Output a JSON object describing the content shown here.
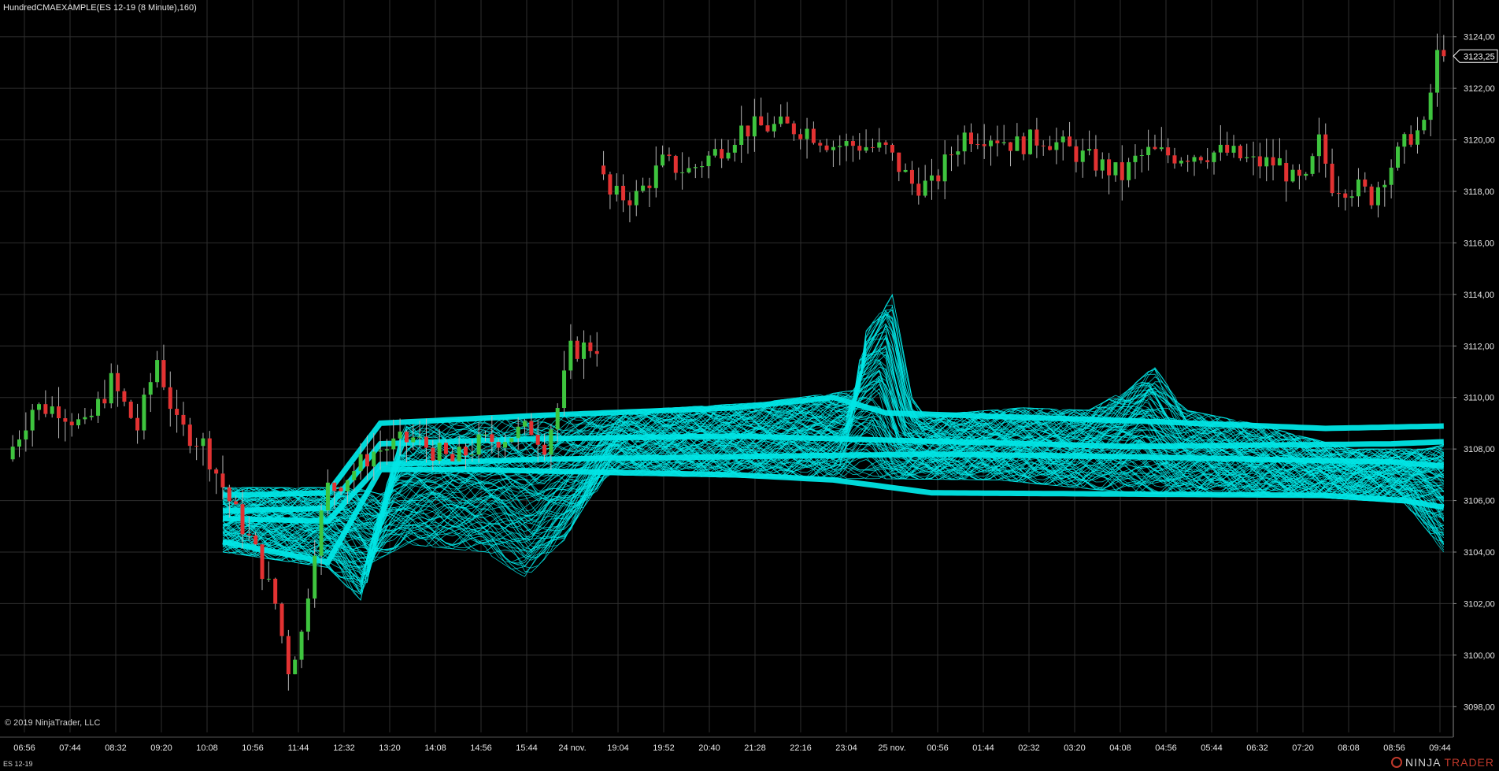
{
  "header": {
    "title": "HundredCMAEXAMPLE(ES 12-19 (8 Minute),160)"
  },
  "footer": {
    "copyright": "© 2019 NinjaTrader, LLC",
    "instrument": "ES 12-19",
    "logo_left": "NINJA",
    "logo_right": "TRADER"
  },
  "colors": {
    "background": "#000000",
    "grid": "#2e2e2e",
    "axis_text": "#e6e6e6",
    "up_candle": "#3ec43e",
    "down_candle": "#e23232",
    "wick": "#b4b4b4",
    "ma_lines": "#00e5e5",
    "price_marker": "#ffffff"
  },
  "chart_data": {
    "type": "candlestick",
    "instrument": "ES 12-19",
    "interval": "8 Minute",
    "ylim": [
      3097,
      3125
    ],
    "y_ticks": [
      "3098,00",
      "3100,00",
      "3102,00",
      "3104,00",
      "3106,00",
      "3108,00",
      "3110,00",
      "3112,00",
      "3114,00",
      "3116,00",
      "3118,00",
      "3120,00",
      "3122,00",
      "3124,00"
    ],
    "x_tick_labels": [
      "06:56",
      "07:44",
      "08:32",
      "09:20",
      "10:08",
      "10:56",
      "11:44",
      "12:32",
      "13:20",
      "14:08",
      "14:56",
      "15:44",
      "24 nov.",
      "19:04",
      "19:52",
      "20:40",
      "21:28",
      "22:16",
      "23:04",
      "25 nov.",
      "00:56",
      "01:44",
      "02:32",
      "03:20",
      "04:08",
      "04:56",
      "05:44",
      "06:32",
      "07:20",
      "08:08",
      "08:56",
      "09:44"
    ],
    "last_price": "3123,25",
    "grid": true,
    "price_segments": [
      {
        "n": 50,
        "anchors": [
          [
            0,
            3107.6
          ],
          [
            4,
            3109.6
          ],
          [
            8,
            3109.6
          ],
          [
            12,
            3108.8
          ],
          [
            16,
            3110.6
          ],
          [
            20,
            3108.8
          ],
          [
            23,
            3111.5
          ],
          [
            26,
            3108.9
          ],
          [
            30,
            3108.2
          ],
          [
            34,
            3106
          ],
          [
            38,
            3104
          ],
          [
            41,
            3102
          ],
          [
            43,
            3099.5
          ],
          [
            45,
            3100.8
          ],
          [
            47,
            3104.3
          ],
          [
            49,
            3106.5
          ]
        ]
      },
      {
        "n": 40,
        "anchors": [
          [
            0,
            3106.5
          ],
          [
            6,
            3107.9
          ],
          [
            12,
            3108.4
          ],
          [
            18,
            3107.5
          ],
          [
            22,
            3108.2
          ],
          [
            26,
            3108.5
          ],
          [
            30,
            3108.8
          ],
          [
            32,
            3108.2
          ],
          [
            34,
            3109.6
          ],
          [
            36,
            3111.8
          ],
          [
            39,
            3112
          ]
        ]
      },
      {
        "n": 104,
        "anchors": [
          [
            0,
            3119
          ],
          [
            2,
            3117.8
          ],
          [
            6,
            3117.8
          ],
          [
            10,
            3119.1
          ],
          [
            14,
            3118.8
          ],
          [
            18,
            3119.5
          ],
          [
            22,
            3120.4
          ],
          [
            25,
            3120.5
          ],
          [
            28,
            3120.5
          ],
          [
            32,
            3120.4
          ],
          [
            36,
            3119.8
          ],
          [
            40,
            3119.8
          ],
          [
            44,
            3119.6
          ],
          [
            48,
            3118.3
          ],
          [
            51,
            3118.2
          ],
          [
            54,
            3119.5
          ],
          [
            56,
            3120.2
          ],
          [
            60,
            3120.2
          ],
          [
            64,
            3119.8
          ],
          [
            68,
            3120.1
          ],
          [
            72,
            3119.6
          ],
          [
            76,
            3119.1
          ],
          [
            80,
            3118.6
          ],
          [
            82,
            3119.2
          ],
          [
            84,
            3119.5
          ],
          [
            88,
            3119.4
          ],
          [
            92,
            3119.5
          ],
          [
            96,
            3119.5
          ],
          [
            100,
            3119.1
          ],
          [
            104,
            3119.1
          ]
        ]
      },
      {
        "n": 25,
        "anchors": [
          [
            0,
            3119.1
          ],
          [
            2,
            3118.4
          ],
          [
            4,
            3118.3
          ],
          [
            6,
            3119.9
          ],
          [
            8,
            3118.3
          ],
          [
            12,
            3118.1
          ],
          [
            14,
            3117.8
          ],
          [
            16,
            3118.7
          ],
          [
            18,
            3119.4
          ],
          [
            20,
            3120.2
          ],
          [
            22,
            3120.4
          ],
          [
            24,
            3123.25
          ]
        ]
      }
    ],
    "moving_average_series": {
      "name_hint": "100 cumulative moving averages",
      "count": 100,
      "start_bar": 32,
      "lower_envelope": [
        [
          32,
          3104
        ],
        [
          48,
          3103.4
        ],
        [
          53,
          3102.1
        ],
        [
          54,
          3103.5
        ],
        [
          60,
          3104.3
        ],
        [
          72,
          3104
        ],
        [
          78,
          3103
        ],
        [
          84,
          3104.5
        ],
        [
          90,
          3107
        ],
        [
          110,
          3106.9
        ],
        [
          150,
          3106.8
        ],
        [
          170,
          3106.3
        ],
        [
          200,
          3106.1
        ],
        [
          212,
          3105.9
        ],
        [
          218,
          3104
        ],
        [
          222,
          3102
        ],
        [
          225,
          3100.4
        ],
        [
          230,
          3100.5
        ]
      ],
      "upper_envelope": [
        [
          32,
          3106.5
        ],
        [
          48,
          3106.5
        ],
        [
          53,
          3106.2
        ],
        [
          56,
          3109.1
        ],
        [
          70,
          3109.2
        ],
        [
          90,
          3109.5
        ],
        [
          110,
          3109.8
        ],
        [
          125,
          3110.3
        ],
        [
          126,
          3112.5
        ],
        [
          130,
          3114.2
        ],
        [
          133,
          3110
        ],
        [
          135,
          3109.3
        ],
        [
          150,
          3109.6
        ],
        [
          160,
          3109.5
        ],
        [
          166,
          3110.3
        ],
        [
          170,
          3111.2
        ],
        [
          175,
          3109.5
        ],
        [
          185,
          3109
        ],
        [
          200,
          3108
        ],
        [
          212,
          3108
        ],
        [
          218,
          3108.5
        ],
        [
          225,
          3110.3
        ],
        [
          230,
          3111.4
        ]
      ],
      "core_lines": [
        [
          [
            32,
            3104.4
          ],
          [
            48,
            3103.6
          ],
          [
            56,
            3107.2
          ],
          [
            70,
            3107.2
          ],
          [
            110,
            3107
          ],
          [
            125,
            3106.8
          ],
          [
            140,
            3106.3
          ],
          [
            200,
            3106.2
          ],
          [
            212,
            3106
          ],
          [
            230,
            3105.2
          ]
        ],
        [
          [
            32,
            3105.3
          ],
          [
            48,
            3105.2
          ],
          [
            56,
            3107.4
          ],
          [
            80,
            3107.6
          ],
          [
            110,
            3107.7
          ],
          [
            140,
            3107.8
          ],
          [
            170,
            3107.7
          ],
          [
            210,
            3107.5
          ],
          [
            220,
            3107.3
          ],
          [
            230,
            3108.4
          ]
        ],
        [
          [
            32,
            3105.6
          ],
          [
            48,
            3105.7
          ],
          [
            56,
            3108.2
          ],
          [
            80,
            3108.4
          ],
          [
            110,
            3108.5
          ],
          [
            140,
            3108.3
          ],
          [
            170,
            3108.1
          ],
          [
            210,
            3108.2
          ],
          [
            220,
            3108.3
          ],
          [
            230,
            3109.6
          ]
        ],
        [
          [
            32,
            3106.2
          ],
          [
            48,
            3106.3
          ],
          [
            56,
            3109
          ],
          [
            80,
            3109.3
          ],
          [
            110,
            3109.6
          ],
          [
            125,
            3110
          ],
          [
            133,
            3109.4
          ],
          [
            170,
            3109.1
          ],
          [
            200,
            3108.8
          ],
          [
            220,
            3108.9
          ],
          [
            230,
            3110.4
          ]
        ]
      ]
    }
  }
}
